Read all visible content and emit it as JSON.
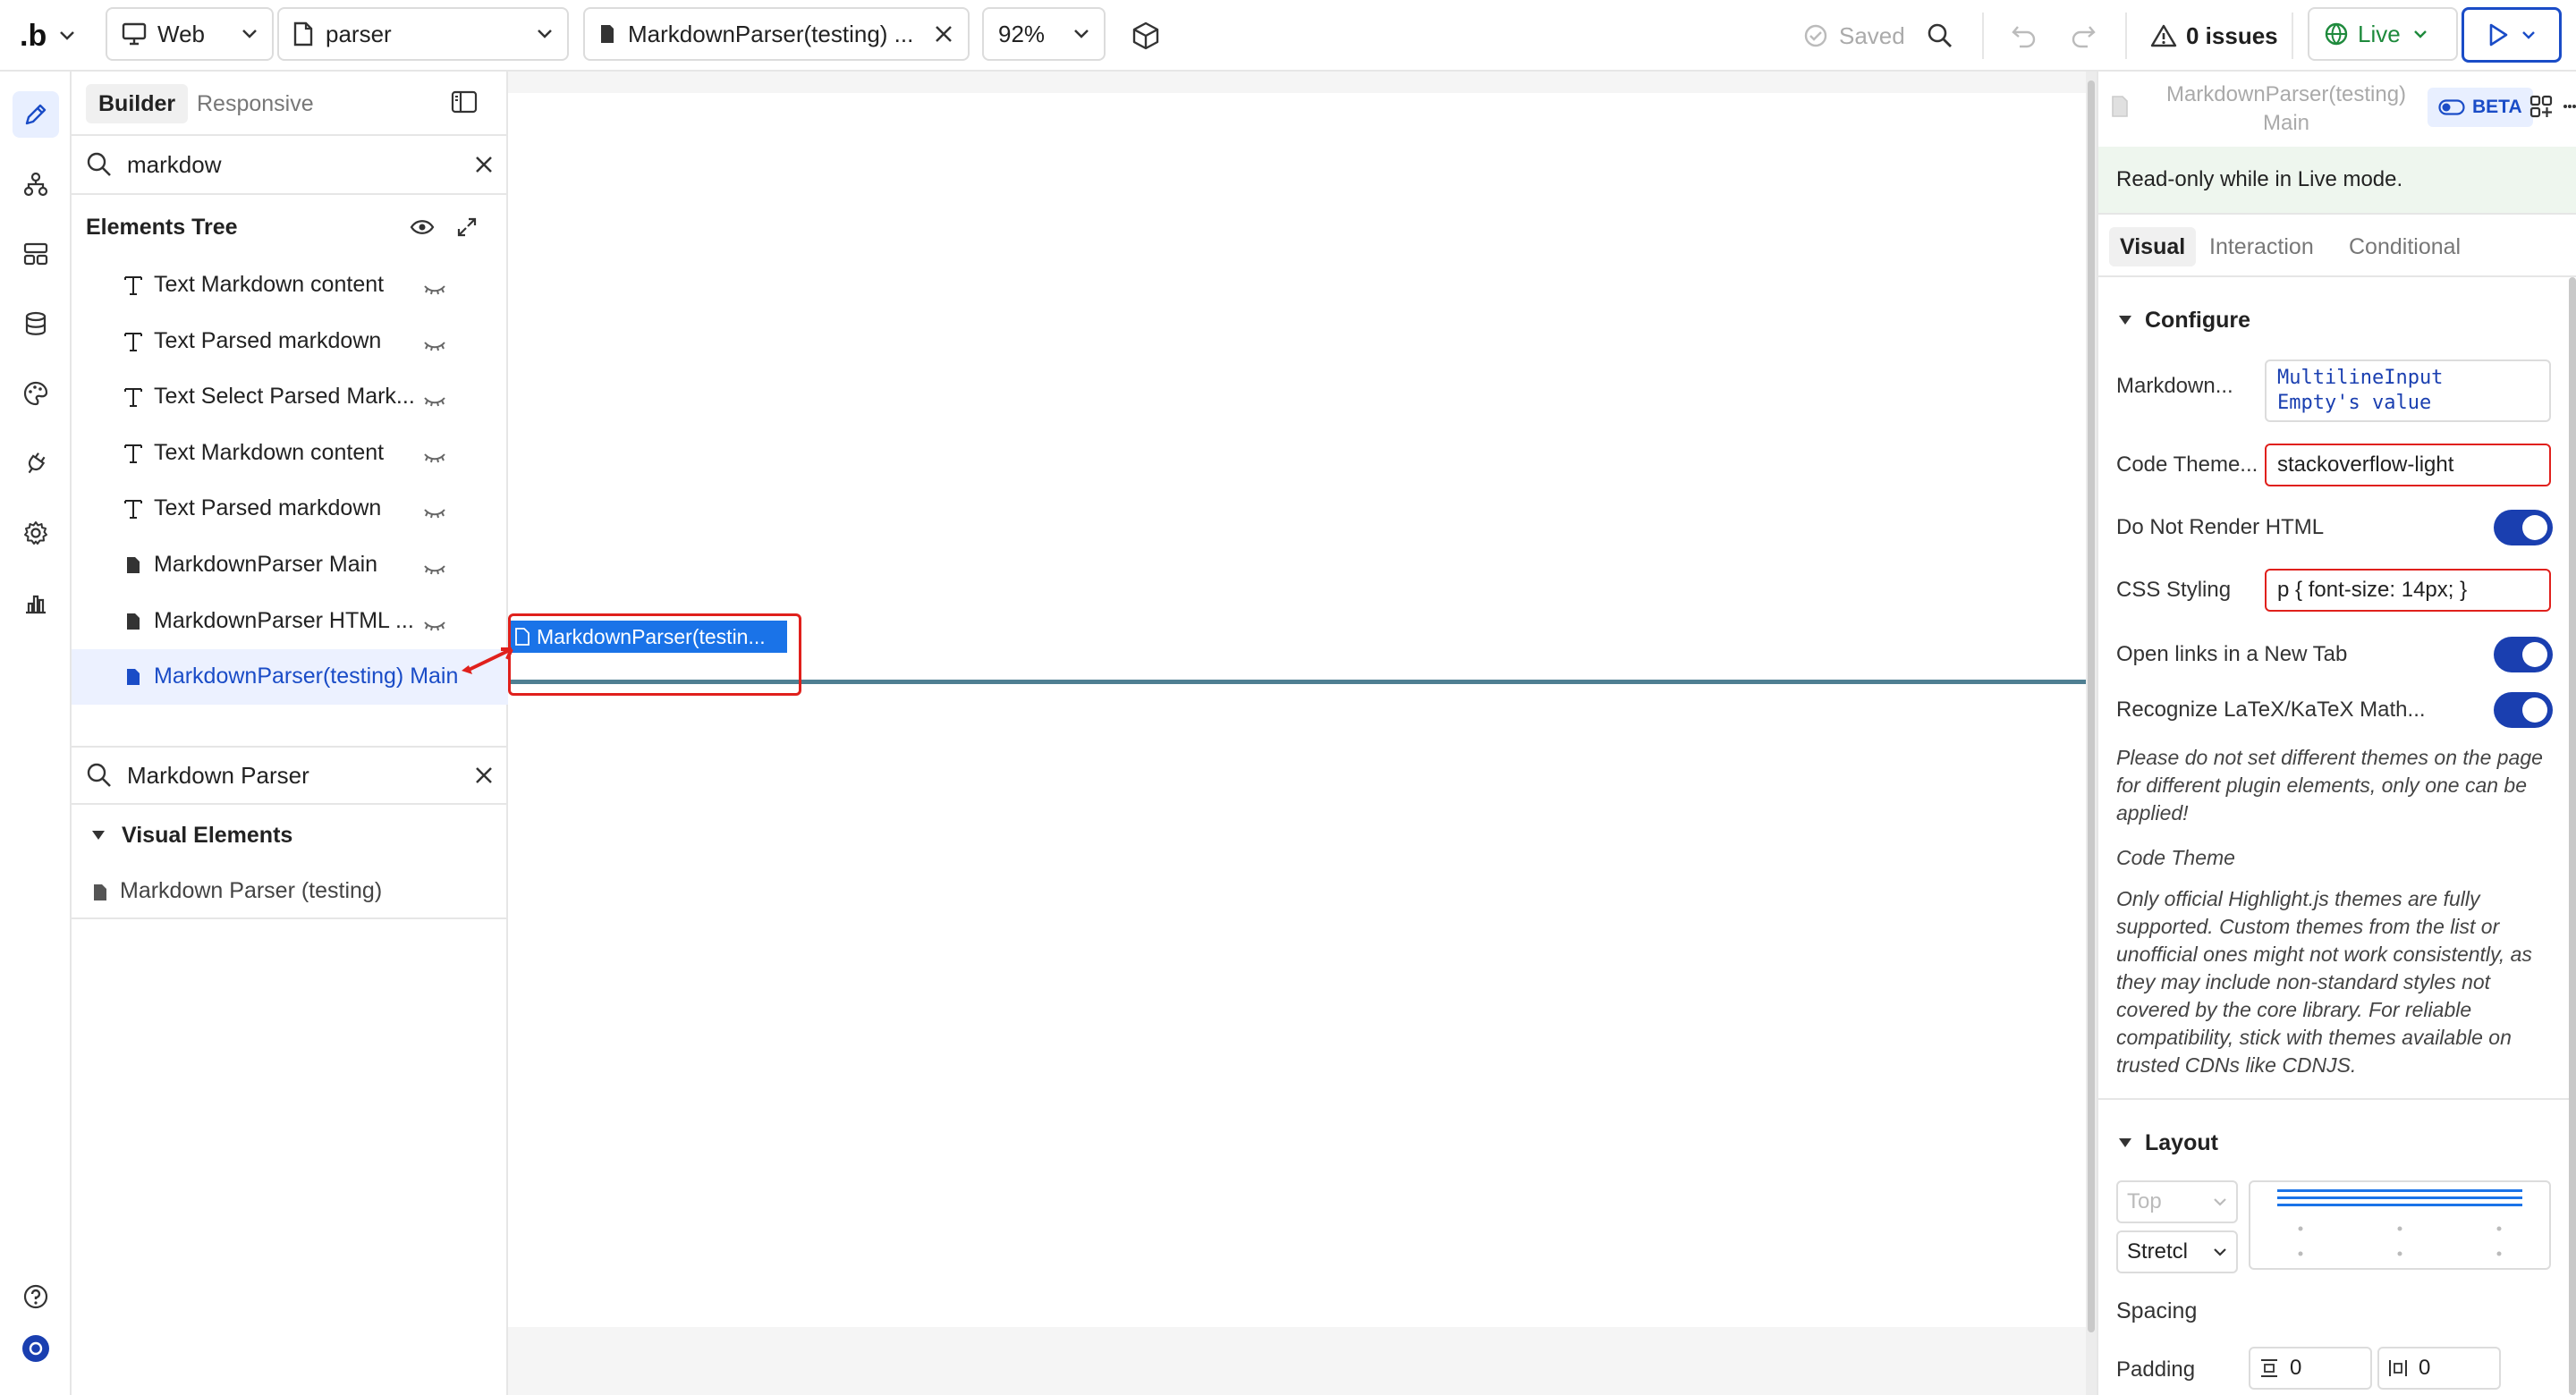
{
  "topbar": {
    "logo": ".b",
    "platform": "Web",
    "page": "parser",
    "element_tab": "MarkdownParser(testing) ...",
    "zoom": "92%",
    "saved": "Saved",
    "issues": "0 issues",
    "live": "Live"
  },
  "left": {
    "tab_builder": "Builder",
    "tab_responsive": "Responsive",
    "tree_search": "markdow",
    "tree_title": "Elements Tree",
    "tree_items": [
      {
        "icon": "text",
        "label": "Text Markdown content"
      },
      {
        "icon": "text",
        "label": "Text Parsed markdown"
      },
      {
        "icon": "text",
        "label": "Text Select Parsed Mark..."
      },
      {
        "icon": "text",
        "label": "Text Markdown content"
      },
      {
        "icon": "text",
        "label": "Text Parsed markdown"
      },
      {
        "icon": "doc",
        "label": "MarkdownParser Main"
      },
      {
        "icon": "doc",
        "label": "MarkdownParser HTML ..."
      },
      {
        "icon": "doc",
        "label": "MarkdownParser(testing) Main"
      }
    ],
    "palette_search": "Markdown Parser",
    "palette_section": "Visual Elements",
    "palette_item": "Markdown Parser (testing)"
  },
  "canvas": {
    "element_label": "MarkdownParser(testin..."
  },
  "right": {
    "title_line1": "MarkdownParser(testing)",
    "title_line2": "Main",
    "beta": "BETA",
    "readonly": "Read-only while in Live mode.",
    "tabs": [
      "Visual",
      "Interaction",
      "Conditional"
    ],
    "configure": "Configure",
    "props": {
      "markdown_label": "Markdown...",
      "markdown_value_line1": "MultilineInput",
      "markdown_value_line2": "Empty's value",
      "code_theme_label": "Code Theme...",
      "code_theme_value": "stackoverflow-light",
      "no_html_label": "Do Not Render HTML",
      "css_label": "CSS Styling",
      "css_value": "p { font-size: 14px; }",
      "new_tab_label": "Open links in a New Tab",
      "latex_label": "Recognize LaTeX/KaTeX Math..."
    },
    "note1": "Please do not set different themes on the page for different plugin elements, only one can be applied!",
    "note2": "Code Theme",
    "note3": "Only official Highlight.js themes are fully supported. Custom themes from the list or unofficial ones might not work consistently, as they may include non-standard styles not covered by the core library. For reliable compatibility, stick with themes available on trusted CDNs like CDNJS.",
    "layout": "Layout",
    "layout_top": "Top",
    "layout_stretch": "Stretcl",
    "spacing": "Spacing",
    "padding": "Padding",
    "padding_v": "0",
    "padding_h": "0"
  },
  "colors": {
    "accent": "#1a4cc7",
    "selection": "#1a73e8",
    "annotation_red": "#e0201c",
    "live_green": "#1e8a3c"
  }
}
